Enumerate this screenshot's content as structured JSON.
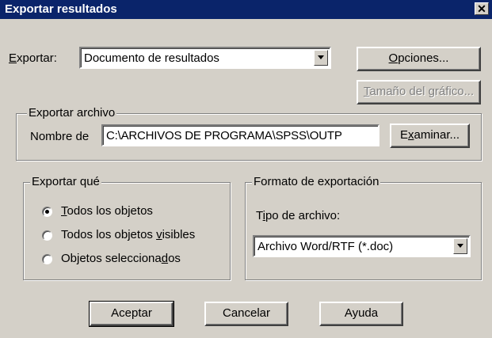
{
  "window": {
    "title": "Exportar resultados",
    "close_glyph": "✕"
  },
  "export": {
    "label_prefix": "",
    "label_mnemonic": "E",
    "label_rest": "xportar:",
    "selected": "Documento de resultados"
  },
  "options_button": {
    "mnemonic": "O",
    "rest": "pciones..."
  },
  "chart_size_button": {
    "mnemonic": "T",
    "rest": "amaño del gráfico..."
  },
  "export_file": {
    "group_title": "Exportar archivo",
    "name_label": "Nombre de",
    "path": "C:\\ARCHIVOS DE PROGRAMA\\SPSS\\OUTP",
    "browse_prefix": "E",
    "browse_mnemonic": "x",
    "browse_rest": "aminar..."
  },
  "export_what": {
    "group_title": "Exportar qué",
    "options": [
      {
        "prefix": "",
        "mnemonic": "T",
        "rest": "odos los objetos",
        "checked": true
      },
      {
        "prefix": "Todos los objetos ",
        "mnemonic": "v",
        "rest": "isibles",
        "checked": false
      },
      {
        "prefix": "Objetos selecciona",
        "mnemonic": "d",
        "rest": "os",
        "checked": false
      }
    ]
  },
  "export_format": {
    "group_title": "Formato de exportación",
    "type_prefix": "T",
    "type_mnemonic": "i",
    "type_rest": "po de archivo:",
    "selected": "Archivo Word/RTF (*.doc)"
  },
  "buttons": {
    "ok": "Aceptar",
    "cancel": "Cancelar",
    "help": "Ayuda"
  }
}
